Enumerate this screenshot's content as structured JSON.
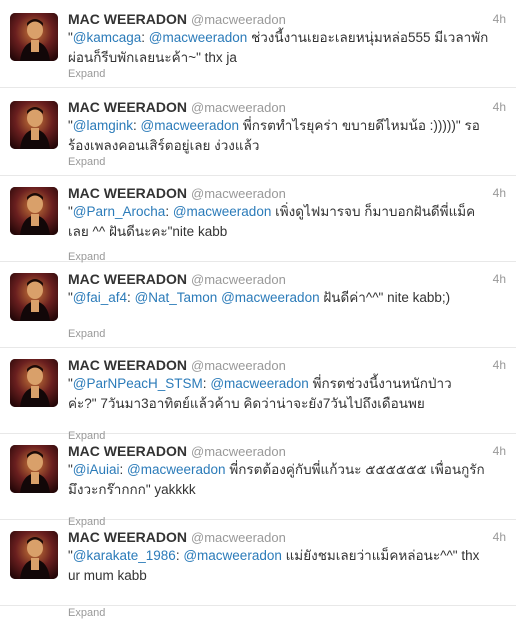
{
  "tweets": [
    {
      "fullname": "MAC WEERADON",
      "username": "@macweeradon",
      "time": "4h",
      "text": "\"@kamcaga: @macweeradon ช่วงนี้งานเยอะเลยหนุ่มหล่อ555 มีเวลาพักผ่อนก็รีบพักเลยนะค้า~\" thx ja",
      "mentions": [
        "@kamcaga",
        "@macweeradon"
      ],
      "expand": "Expand"
    },
    {
      "fullname": "MAC WEERADON",
      "username": "@macweeradon",
      "time": "4h",
      "text": "\"@lamgink: @macweeradon พี่กรตทำไรยุคร่า ขบายดีไหมน้อ :)))))\" รอร้องเพลงคอนเสิร์ตอยู่เลย ง่วงแล้ว",
      "mentions": [
        "@lamgink",
        "@macweeradon"
      ],
      "expand": "Expand"
    },
    {
      "fullname": "MAC WEERADON",
      "username": "@macweeradon",
      "time": "4h",
      "text": "\"@Parn_Arocha: @macweeradon เพิ่งดูไฟมารจบ ก็มาบอกฝันดีพี่แม็คเลย ^^ ฝันดีนะคะ\"nite kabb",
      "mentions": [
        "@Parn_Arocha",
        "@macweeradon"
      ],
      "expand": "Expand"
    },
    {
      "fullname": "MAC WEERADON",
      "username": "@macweeradon",
      "time": "4h",
      "text": "\"@fai_af4: @Nat_Tamon @macweeradon ฝันดีค่า^^\" nite kabb;)",
      "mentions": [
        "@fai_af4",
        "@Nat_Tamon",
        "@macweeradon"
      ],
      "expand": "Expand"
    },
    {
      "fullname": "MAC WEERADON",
      "username": "@macweeradon",
      "time": "4h",
      "text": "\"@ParNPeacH_STSM: @macweeradon พี่กรตช่วงนี้งานหนักป่าวค่ะ?\" 7วันมา3อาทิตย์แล้วค้าบ คิดว่าน่าจะยัง7วันไปถึงเดือนพย",
      "mentions": [
        "@ParNPeacH_STSM",
        "@macweeradon"
      ],
      "expand": "Expand"
    },
    {
      "fullname": "MAC WEERADON",
      "username": "@macweeradon",
      "time": "4h",
      "text": "\"@iAuiai: @macweeradon พี่กรตต้องคู่กับพี่แก้วนะ ๕๕๕๕๕๕ เพื่อนกูรักมึงวะกร๊ากกก\" yakkkk",
      "mentions": [
        "@iAuiai",
        "@macweeradon"
      ],
      "expand": "Expand"
    },
    {
      "fullname": "MAC WEERADON",
      "username": "@macweeradon",
      "time": "4h",
      "text": "\"@karakate_1986: @macweeradon แม่ยังชมเลยว่าแม็คหล่อนะ^^\" thx ur mum kabb",
      "mentions": [
        "@karakate_1986",
        "@macweeradon"
      ],
      "expand": "Expand"
    }
  ],
  "colors": {
    "link": "#2b7bb9",
    "muted": "#999999",
    "text": "#333333"
  }
}
